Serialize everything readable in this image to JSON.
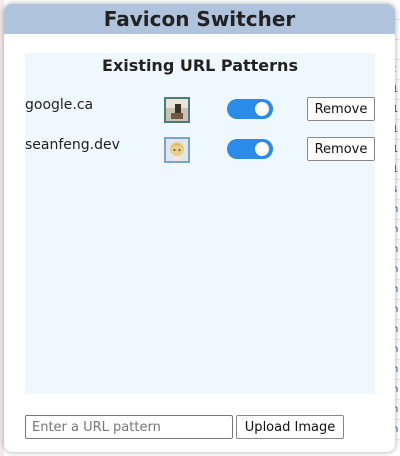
{
  "app": {
    "title": "Favicon Switcher"
  },
  "panel": {
    "heading": "Existing URL Patterns"
  },
  "patterns": [
    {
      "url": "google.ca",
      "enabled": true,
      "remove_label": "Remove",
      "thumb": "photo-thumbnail"
    },
    {
      "url": "seanfeng.dev",
      "enabled": true,
      "remove_label": "Remove",
      "thumb": "anime-avatar-thumbnail"
    }
  ],
  "footer": {
    "input_value": "",
    "input_placeholder": "Enter a URL pattern",
    "upload_label": "Upload Image"
  },
  "colors": {
    "title_bar": "#b0c4de",
    "panel_bg": "#f0f8ff",
    "toggle_on": "#2a8ce8"
  }
}
